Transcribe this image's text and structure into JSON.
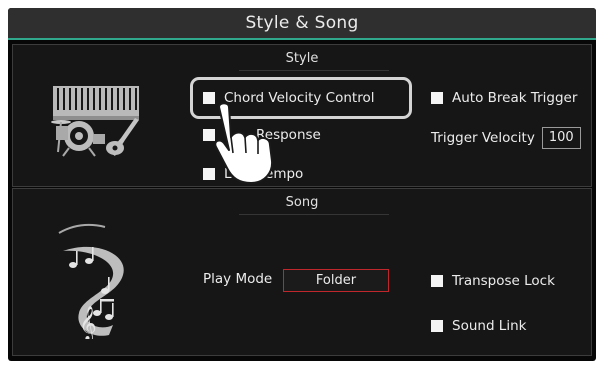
{
  "window": {
    "title": "Style & Song"
  },
  "style": {
    "heading": "Style",
    "chord_velocity_control": "Chord Velocity Control",
    "chord_response": "Response",
    "lock_tempo": "Lock Tempo",
    "auto_break_trigger": "Auto Break Trigger",
    "trigger_velocity_label": "Trigger Velocity",
    "trigger_velocity_value": "100",
    "icon": "instruments-icon"
  },
  "song": {
    "heading": "Song",
    "play_mode_label": "Play Mode",
    "play_mode_value": "Folder",
    "transpose_lock": "Transpose Lock",
    "sound_link": "Sound Link",
    "icon": "music-notes-icon"
  },
  "overlay": {
    "icon": "pointing-hand-icon"
  },
  "colors": {
    "accent": "#2fa88c",
    "dropdown_border": "#c0272d",
    "background": "#070707",
    "panel": "#161616"
  }
}
